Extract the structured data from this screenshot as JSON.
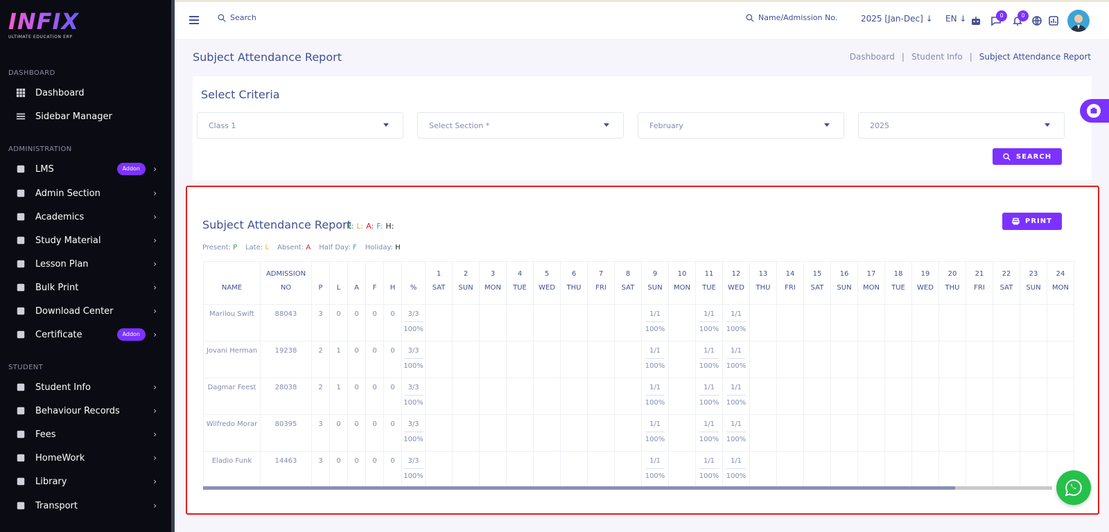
{
  "brand": {
    "logo_text": "INFIX",
    "tagline": "ULTIMATE EDUCATION ERP"
  },
  "sidebar": {
    "sections": [
      {
        "title": "DASHBOARD",
        "items": [
          {
            "label": "Dashboard",
            "icon": "grid-icon"
          },
          {
            "label": "Sidebar Manager",
            "icon": "list-icon"
          }
        ]
      },
      {
        "title": "ADMINISTRATION",
        "items": [
          {
            "label": "LMS",
            "icon": "user-graduate-icon",
            "badge": "Addon"
          },
          {
            "label": "Admin Section",
            "icon": "admin-icon"
          },
          {
            "label": "Academics",
            "icon": "graduation-cap-icon"
          },
          {
            "label": "Study Material",
            "icon": "download-icon"
          },
          {
            "label": "Lesson Plan",
            "icon": "lesson-plan-icon"
          },
          {
            "label": "Bulk Print",
            "icon": "printer-icon"
          },
          {
            "label": "Download Center",
            "icon": "download-center-icon"
          },
          {
            "label": "Certificate",
            "icon": "book-icon",
            "badge": "Addon"
          }
        ]
      },
      {
        "title": "STUDENT",
        "items": [
          {
            "label": "Student Info",
            "icon": "user-icon"
          },
          {
            "label": "Behaviour Records",
            "icon": "records-icon"
          },
          {
            "label": "Fees",
            "icon": "money-icon"
          },
          {
            "label": "HomeWork",
            "icon": "homework-icon"
          },
          {
            "label": "Library",
            "icon": "library-icon"
          },
          {
            "label": "Transport",
            "icon": "transport-icon"
          }
        ]
      }
    ]
  },
  "header": {
    "search_label": "Search",
    "admission_search_label": "Name/Admission No.",
    "session": "2025 [Jan-Dec]",
    "language": "EN",
    "chat_count": "0",
    "notification_count": "0"
  },
  "page": {
    "title": "Subject Attendance Report",
    "breadcrumb": [
      "Dashboard",
      "Student Info",
      "Subject Attendance Report"
    ],
    "breadcrumb_sep": "|"
  },
  "criteria": {
    "title": "Select Criteria",
    "class_value": "Class 1",
    "section_placeholder": "Select Section *",
    "month_value": "February",
    "year_value": "2025",
    "search_button": "SEARCH"
  },
  "report": {
    "title": "Subject Attendance Report",
    "print_button": "PRINT",
    "legend_inline": [
      {
        "code": "P:",
        "cls": "c-p"
      },
      {
        "code": "L:",
        "cls": "c-l"
      },
      {
        "code": "A:",
        "cls": "c-a"
      },
      {
        "code": "F:",
        "cls": "c-f"
      },
      {
        "code": "H:",
        "cls": "c-h"
      }
    ],
    "legend": [
      {
        "label": "Present:",
        "code": "P",
        "cls": "c-p"
      },
      {
        "label": "Late:",
        "code": "L",
        "cls": "c-l"
      },
      {
        "label": "Absent:",
        "code": "A",
        "cls": "c-a"
      },
      {
        "label": "Half Day:",
        "code": "F",
        "cls": "c-f"
      },
      {
        "label": "Holiday:",
        "code": "H",
        "cls": "c-h"
      }
    ],
    "columns": {
      "name": "NAME",
      "admission": [
        "ADMISSION",
        "NO"
      ],
      "stats": [
        "P",
        "L",
        "A",
        "F",
        "H",
        "%"
      ]
    },
    "days": [
      [
        "1",
        "SAT"
      ],
      [
        "2",
        "SUN"
      ],
      [
        "3",
        "MON"
      ],
      [
        "4",
        "TUE"
      ],
      [
        "5",
        "WED"
      ],
      [
        "6",
        "THU"
      ],
      [
        "7",
        "FRI"
      ],
      [
        "8",
        "SAT"
      ],
      [
        "9",
        "SUN"
      ],
      [
        "10",
        "MON"
      ],
      [
        "11",
        "TUE"
      ],
      [
        "12",
        "WED"
      ],
      [
        "13",
        "THU"
      ],
      [
        "14",
        "FRI"
      ],
      [
        "15",
        "SAT"
      ],
      [
        "16",
        "SUN"
      ],
      [
        "17",
        "MON"
      ],
      [
        "18",
        "TUE"
      ],
      [
        "19",
        "WED"
      ],
      [
        "20",
        "THU"
      ],
      [
        "21",
        "FRI"
      ],
      [
        "22",
        "SAT"
      ],
      [
        "23",
        "SUN"
      ],
      [
        "24",
        "MON"
      ]
    ],
    "rows": [
      {
        "name": "Marilou Swift",
        "admission": "88043",
        "p": "3",
        "l": "0",
        "a": "0",
        "f": "0",
        "h": "0",
        "frac": "3/3",
        "pct": "100%",
        "marks": {
          "9": [
            "1/1",
            "100%"
          ],
          "11": [
            "1/1",
            "100%"
          ],
          "12": [
            "1/1",
            "100%"
          ]
        }
      },
      {
        "name": "Jovani Herman",
        "admission": "19238",
        "p": "2",
        "l": "1",
        "a": "0",
        "f": "0",
        "h": "0",
        "frac": "3/3",
        "pct": "100%",
        "marks": {
          "9": [
            "1/1",
            "100%"
          ],
          "11": [
            "1/1",
            "100%"
          ],
          "12": [
            "1/1",
            "100%"
          ]
        }
      },
      {
        "name": "Dagmar Feest",
        "admission": "28038",
        "p": "2",
        "l": "1",
        "a": "0",
        "f": "0",
        "h": "0",
        "frac": "3/3",
        "pct": "100%",
        "marks": {
          "9": [
            "1/1",
            "100%"
          ],
          "11": [
            "1/1",
            "100%"
          ],
          "12": [
            "1/1",
            "100%"
          ]
        }
      },
      {
        "name": "Wilfredo Morar",
        "admission": "80395",
        "p": "3",
        "l": "0",
        "a": "0",
        "f": "0",
        "h": "0",
        "frac": "3/3",
        "pct": "100%",
        "marks": {
          "9": [
            "1/1",
            "100%"
          ],
          "11": [
            "1/1",
            "100%"
          ],
          "12": [
            "1/1",
            "100%"
          ]
        }
      },
      {
        "name": "Eladio Funk",
        "admission": "14463",
        "p": "3",
        "l": "0",
        "a": "0",
        "f": "0",
        "h": "0",
        "frac": "3/3",
        "pct": "100%",
        "marks": {
          "9": [
            "1/1",
            "100%"
          ],
          "11": [
            "1/1",
            "100%"
          ],
          "12": [
            "1/1",
            "100%"
          ]
        }
      }
    ]
  },
  "colors": {
    "accent": "#7c32ff",
    "text": "#415094",
    "sidebar_bg": "#0b0b13",
    "highlight_border": "#e31b1b",
    "whatsapp": "#25c14a"
  }
}
